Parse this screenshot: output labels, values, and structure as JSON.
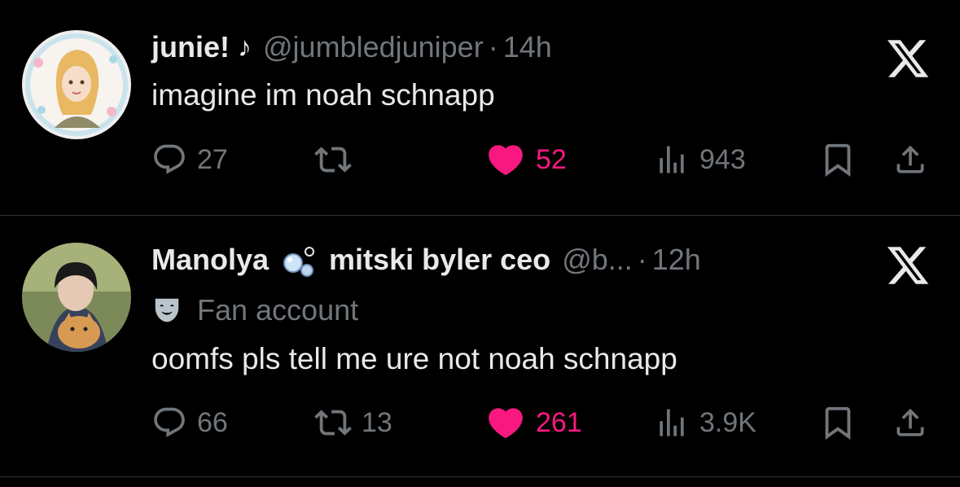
{
  "tweets": [
    {
      "display_name": "junie!",
      "name_emoji": "♪",
      "handle": "@jumbledjuniper",
      "separator": "·",
      "time": "14h",
      "text": "imagine im noah schnapp",
      "stats": {
        "replies": "27",
        "retweets": "",
        "likes": "52",
        "views": "943"
      },
      "liked": true
    },
    {
      "display_name": "Manolya",
      "name_suffix": "mitski byler ceo",
      "handle": "@b...",
      "separator": "·",
      "time": "12h",
      "badge": "Fan account",
      "text": "oomfs pls tell me ure not noah schnapp",
      "stats": {
        "replies": "66",
        "retweets": "13",
        "likes": "261",
        "views": "3.9K"
      },
      "liked": true
    }
  ],
  "colors": {
    "background": "#000000",
    "text": "#e7e9ea",
    "muted": "#71767b",
    "like": "#f91880",
    "divider": "#2f3336"
  },
  "icons": [
    "reply-icon",
    "retweet-icon",
    "heart-icon",
    "views-icon",
    "bookmark-icon",
    "share-icon",
    "x-logo-icon",
    "bubbles-icon",
    "theater-mask-icon"
  ]
}
